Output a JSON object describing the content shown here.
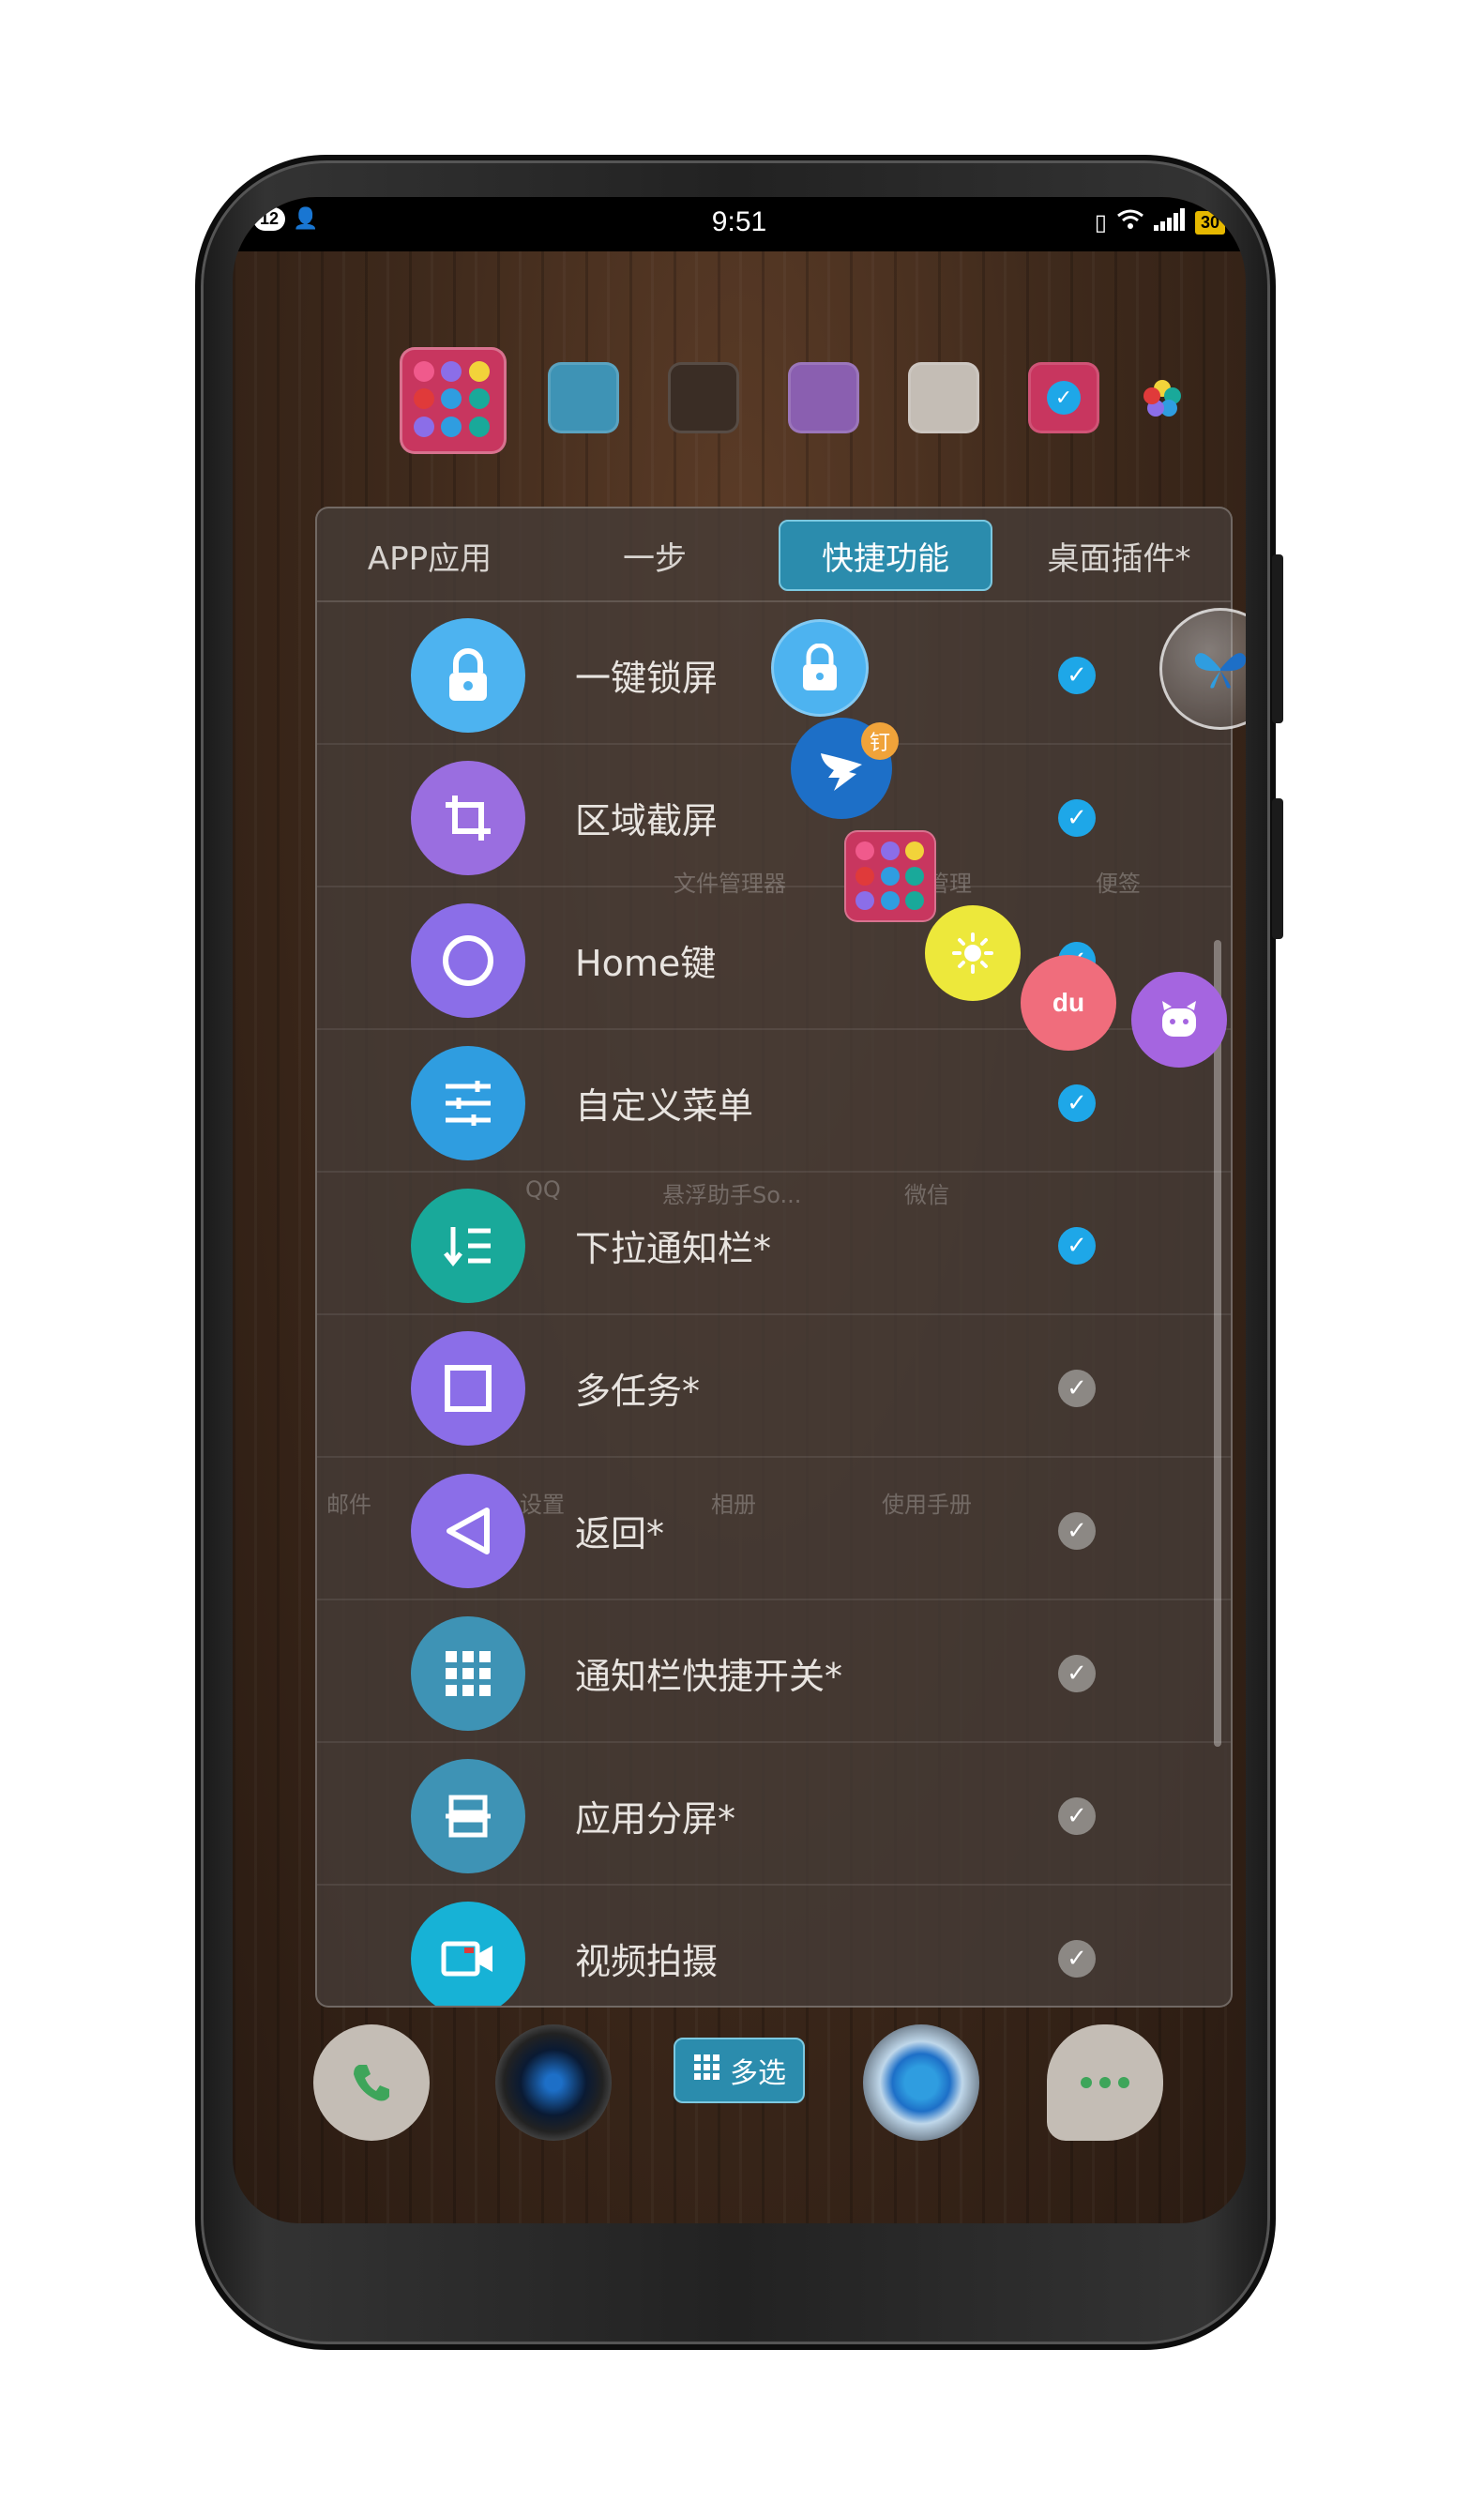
{
  "status_bar": {
    "notif_count": "12",
    "time": "9:51",
    "battery": "30"
  },
  "colors": {
    "tile_1": "#3e93b5",
    "tile_2": "#3a2d25",
    "tile_3": "#8a5fb0",
    "tile_4": "#c4bdb5",
    "tile_5": "#c8365f",
    "accent": "#2b8cad",
    "check_on": "#1ea7e8"
  },
  "tabs": [
    {
      "label": "APP应用"
    },
    {
      "label": "一步"
    },
    {
      "label": "快捷功能"
    },
    {
      "label": "桌面插件*"
    }
  ],
  "active_tab": "快捷功能",
  "items": [
    {
      "label": "一键锁屏",
      "icon": "lock-icon",
      "color": "#4db3f0",
      "checked": true
    },
    {
      "label": "区域截屏",
      "icon": "crop-icon",
      "color": "#9a6ee0",
      "checked": true
    },
    {
      "label": "Home键",
      "icon": "circle-icon",
      "color": "#8b6ee8",
      "checked": true
    },
    {
      "label": "自定义菜单",
      "icon": "sliders-icon",
      "color": "#2f9de0",
      "checked": true
    },
    {
      "label": "下拉通知栏*",
      "icon": "list-icon",
      "color": "#19a99a",
      "checked": true
    },
    {
      "label": "多任务*",
      "icon": "square-icon",
      "color": "#8b6ee8",
      "checked": false
    },
    {
      "label": "返回*",
      "icon": "back-triangle-icon",
      "color": "#8b6ee8",
      "checked": false
    },
    {
      "label": "通知栏快捷开关*",
      "icon": "grid-icon",
      "color": "#3e93b5",
      "checked": false
    },
    {
      "label": "应用分屏*",
      "icon": "split-icon",
      "color": "#3e93b5",
      "checked": false
    },
    {
      "label": "视频拍摄",
      "icon": "video-icon",
      "color": "#17b2d6",
      "checked": false
    }
  ],
  "ghost_labels": {
    "file_manager": "文件管理器",
    "manage": "管理",
    "notes": "便签",
    "qq": "QQ",
    "assistant": "悬浮助手So...",
    "wechat": "微信",
    "mail": "邮件",
    "settings": "设置",
    "album": "相册",
    "manual": "使用手册"
  },
  "float_badges": {
    "dingtalk_badge": "钉",
    "baidu_text": "du"
  },
  "dock": {
    "multi_select_label": "多选"
  }
}
